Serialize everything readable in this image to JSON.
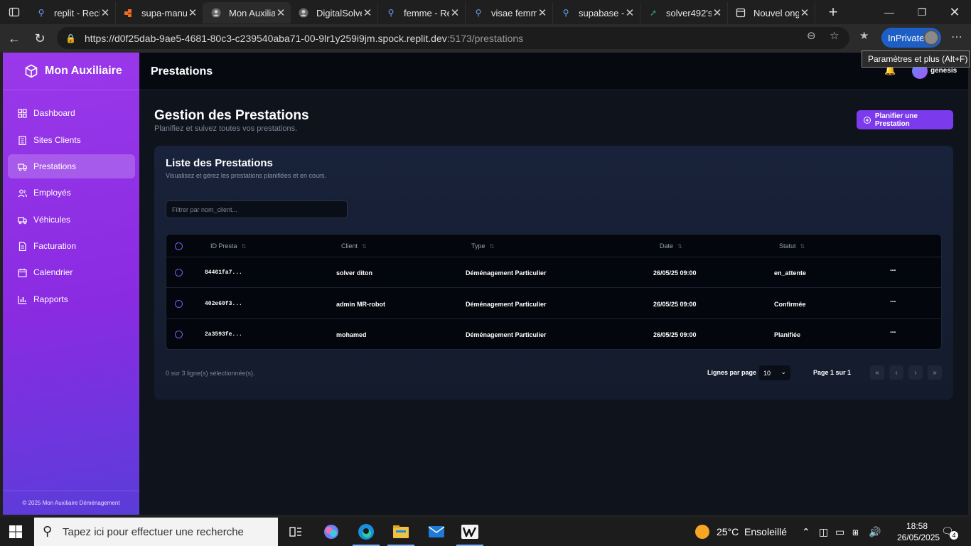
{
  "browser": {
    "tabs": [
      {
        "title": "replit - Rech",
        "icon": "search-icon",
        "active": false
      },
      {
        "title": "supa-manu",
        "icon": "supabase-icon",
        "active": false
      },
      {
        "title": "Mon Auxilia",
        "icon": "avatar-icon",
        "active": true
      },
      {
        "title": "DigitalSolve",
        "icon": "avatar-icon",
        "active": false
      },
      {
        "title": "femme - Re",
        "icon": "search-icon",
        "active": false
      },
      {
        "title": "visae femm",
        "icon": "search-icon",
        "active": false
      },
      {
        "title": "supabase -",
        "icon": "search-icon",
        "active": false
      },
      {
        "title": "solver492's",
        "icon": "bolt-icon",
        "active": false
      },
      {
        "title": "Nouvel ong",
        "icon": "newtab-icon",
        "active": false
      }
    ],
    "url_main": "https://d0f25dab-9ae5-4681-80c3-c239540aba71-00-9lr1y259i9jm.spock.replit.dev",
    "url_tail": ":5173/prestations",
    "inprivate_label": "InPrivate",
    "tooltip": "Paramètres et plus (Alt+F)"
  },
  "app": {
    "brand": "Mon Auxiliaire",
    "nav": [
      {
        "label": "Dashboard",
        "icon": "dashboard-icon",
        "active": false
      },
      {
        "label": "Sites Clients",
        "icon": "building-icon",
        "active": false
      },
      {
        "label": "Prestations",
        "icon": "truck-icon",
        "active": true
      },
      {
        "label": "Employés",
        "icon": "users-icon",
        "active": false
      },
      {
        "label": "Véhicules",
        "icon": "truck-icon",
        "active": false
      },
      {
        "label": "Facturation",
        "icon": "invoice-icon",
        "active": false
      },
      {
        "label": "Calendrier",
        "icon": "calendar-icon",
        "active": false
      },
      {
        "label": "Rapports",
        "icon": "bar-chart-icon",
        "active": false
      }
    ],
    "copyright": "© 2025 Mon Auxiliaire Déménagement",
    "page_title": "Prestations",
    "user_name": "genesis",
    "main_title": "Gestion des Prestations",
    "main_subtitle": "Planifiez et suivez toutes vos prestations.",
    "add_button": "Planifier une Prestation",
    "card_title": "Liste des Prestations",
    "card_subtitle": "Visualisez et gérez les prestations planifiées et en cours.",
    "filter_placeholder": "Filtrer par nom_client...",
    "columns": [
      "ID Presta",
      "Client",
      "Type",
      "Date",
      "Statut"
    ],
    "rows": [
      {
        "id": "84461fa7...",
        "client": "solver diton",
        "type": "Déménagement Particulier",
        "date": "26/05/25 09:00",
        "status": "en_attente"
      },
      {
        "id": "402e60f3...",
        "client": "admin MR-robot",
        "type": "Déménagement Particulier",
        "date": "26/05/25 09:00",
        "status": "Confirmée"
      },
      {
        "id": "2a3593fe...",
        "client": "mohamed",
        "type": "Déménagement Particulier",
        "date": "26/05/25 09:00",
        "status": "Planifiée"
      }
    ],
    "selection_info": "0 sur 3 ligne(s) sélectionnée(s).",
    "rows_per_page_label": "Lignes par page",
    "rows_per_page_value": "10",
    "page_info": "Page 1 sur 1"
  },
  "taskbar": {
    "search_placeholder": "Tapez ici pour effectuer une recherche",
    "weather": "25°C  Ensoleillé",
    "time": "18:58",
    "date": "26/05/2025",
    "notifications": "4"
  }
}
